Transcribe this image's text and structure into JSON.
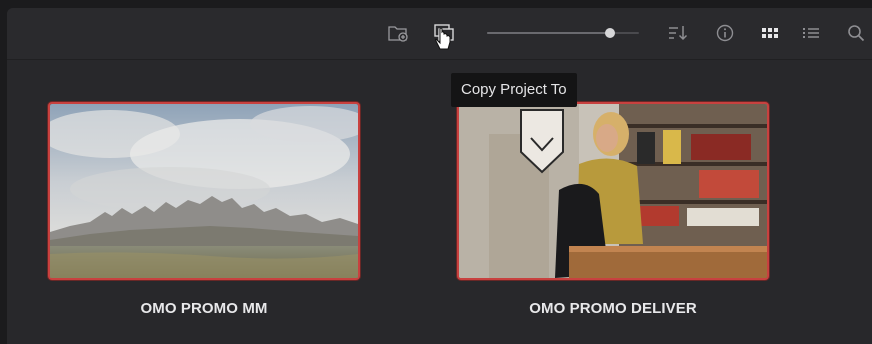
{
  "toolbar": {
    "icons": [
      {
        "name": "new-folder-icon"
      },
      {
        "name": "copy-project-icon"
      },
      {
        "name": "sort-icon"
      },
      {
        "name": "info-icon"
      },
      {
        "name": "grid-view-icon"
      },
      {
        "name": "list-view-icon"
      },
      {
        "name": "search-icon"
      }
    ],
    "zoom_slider": {
      "value": 0.81
    }
  },
  "tooltip": {
    "text": "Copy Project To"
  },
  "projects": [
    {
      "title": "OMO PROMO MM",
      "thumbnail": "desert-mountain-landscape"
    },
    {
      "title": "OMO PROMO DELIVER",
      "thumbnail": "woman-in-clothing-store"
    }
  ],
  "colors": {
    "selection_border": "#c8413f",
    "background": "#28282b",
    "toolbar": "#2a2a2d"
  }
}
